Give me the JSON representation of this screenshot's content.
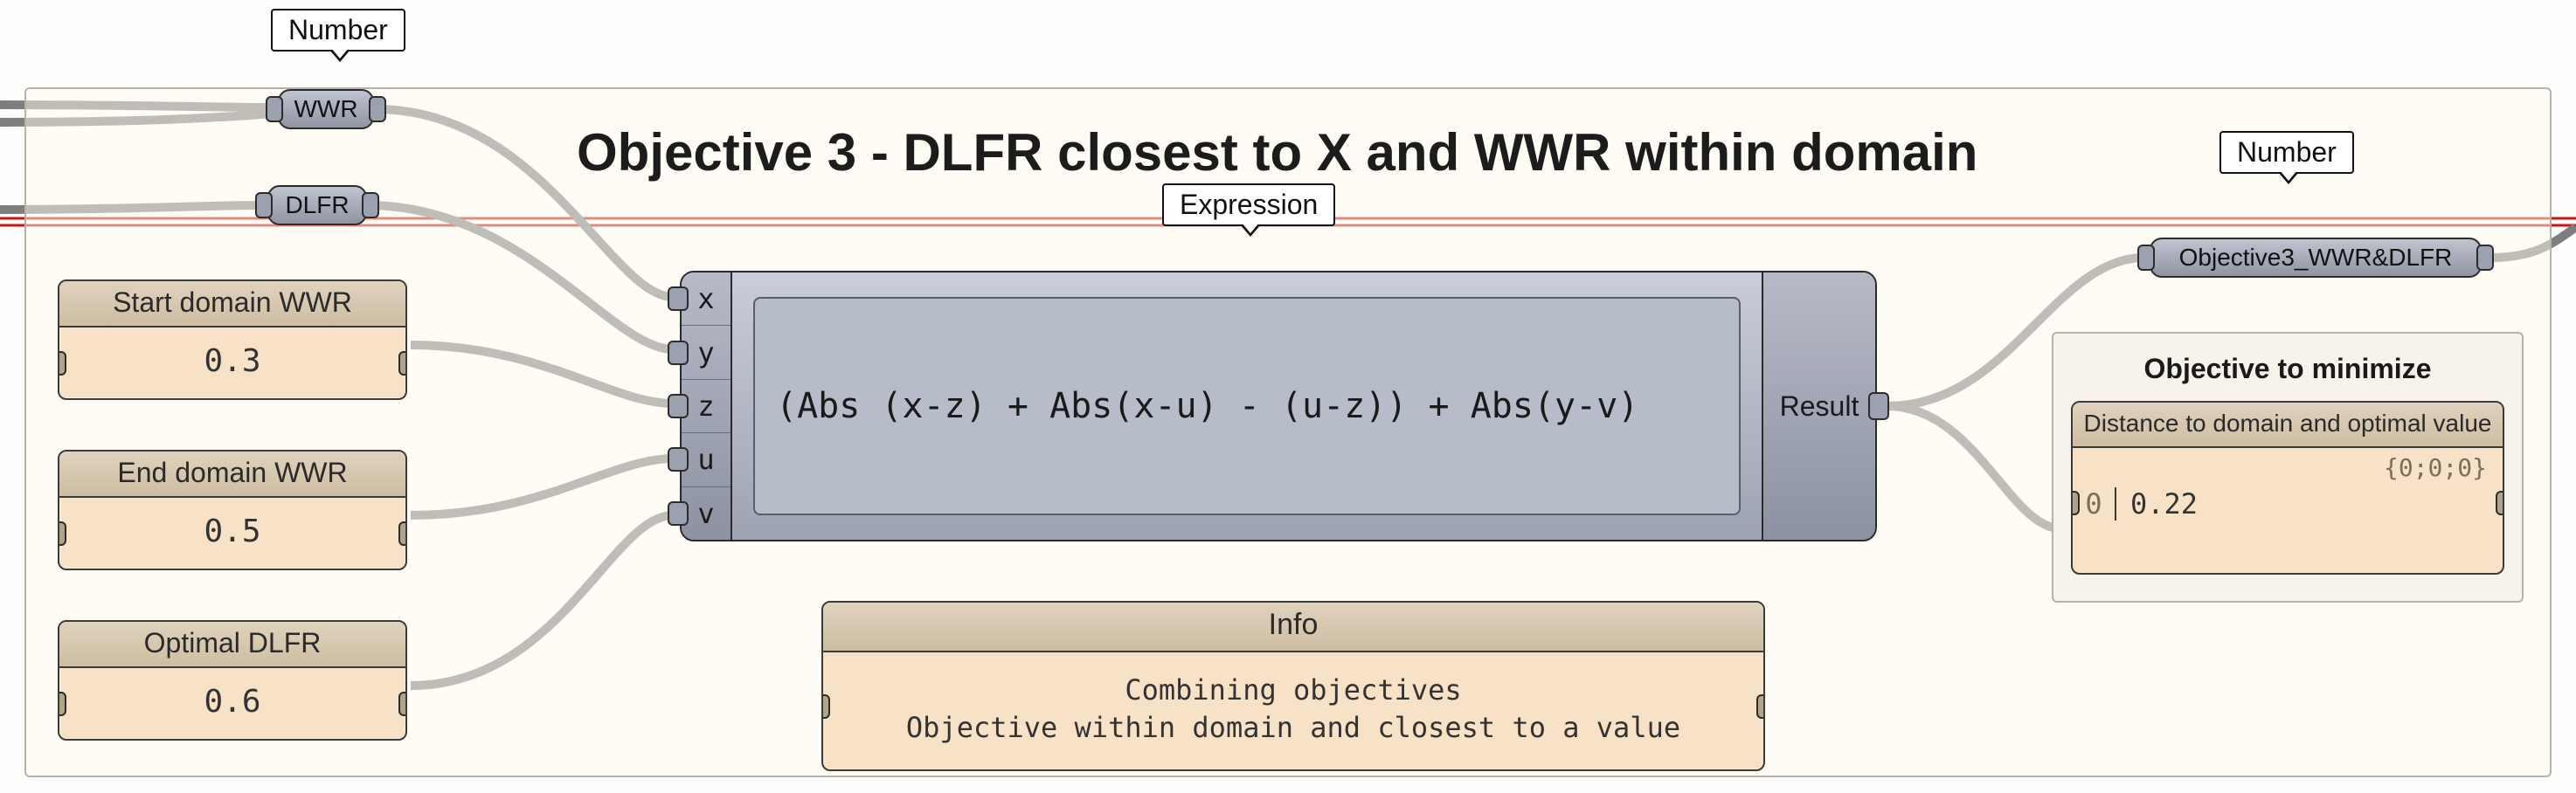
{
  "group_title": "Objective 3 - DLFR closest to X and WWR within domain",
  "tags": {
    "number_left": "Number",
    "expression": "Expression",
    "number_right": "Number"
  },
  "capsules": {
    "wwr": "WWR",
    "dlfr": "DLFR",
    "objective3": "Objective3_WWR&DLFR"
  },
  "panels": {
    "start_wwr": {
      "title": "Start domain WWR",
      "value": "0.3"
    },
    "end_wwr": {
      "title": "End domain WWR",
      "value": "0.5"
    },
    "opt_dlfr": {
      "title": "Optimal DLFR",
      "value": "0.6"
    }
  },
  "expression": {
    "inputs": [
      "x",
      "y",
      "z",
      "u",
      "v"
    ],
    "formula": "(Abs (x-z) + Abs(x-u) - (u-z)) + Abs(y-v)",
    "output_label": "Result"
  },
  "info": {
    "title": "Info",
    "body": "Combining objectives\nObjective within domain and closest to a value"
  },
  "objective_box": {
    "title": "Objective to minimize",
    "inner_title": "Distance to domain and optimal value",
    "branch": "{0;0;0}",
    "index": "0",
    "value": "0.22"
  }
}
